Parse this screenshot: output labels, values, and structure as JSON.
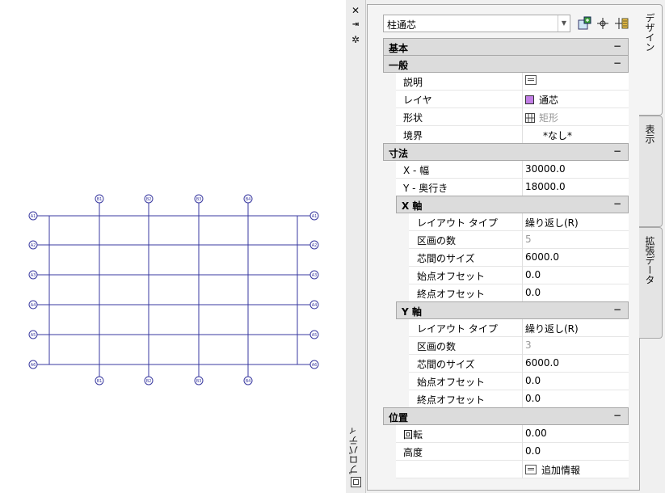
{
  "drawing": {
    "grid_color": "#3a3aa0",
    "col_labels_top": [
      "B1",
      "B2",
      "B3",
      "B4"
    ],
    "col_labels_bottom": [
      "B1",
      "B2",
      "B3",
      "B4"
    ],
    "row_labels_left": [
      "A1",
      "A2",
      "A3",
      "A4",
      "A5",
      "A6"
    ],
    "row_labels_right": [
      "A1",
      "A2",
      "A3",
      "A4",
      "A5",
      "A6"
    ]
  },
  "palette": {
    "title": "プロパティ",
    "style_value": "柱通芯",
    "tabs": [
      "デザイン",
      "表示",
      "拡張データ"
    ],
    "categories": [
      {
        "label": "基本",
        "collapse": "−"
      },
      {
        "label": "一般",
        "collapse": "−",
        "props": [
          {
            "name": "説明",
            "value": ""
          },
          {
            "name": "レイヤ",
            "value": "通芯"
          },
          {
            "name": "形状",
            "value": "矩形"
          },
          {
            "name": "境界",
            "value": "*なし*"
          }
        ]
      },
      {
        "label": "寸法",
        "collapse": "−",
        "props": [
          {
            "name": "X - 幅",
            "value": "30000.0"
          },
          {
            "name": "Y - 奥行き",
            "value": "18000.0"
          }
        ]
      },
      {
        "label": "X 軸",
        "collapse": "−",
        "props": [
          {
            "name": "レイアウト タイプ",
            "value": "繰り返し(R)"
          },
          {
            "name": "区画の数",
            "value": "5"
          },
          {
            "name": "芯間のサイズ",
            "value": "6000.0"
          },
          {
            "name": "始点オフセット",
            "value": "0.0"
          },
          {
            "name": "終点オフセット",
            "value": "0.0"
          }
        ]
      },
      {
        "label": "Y 軸",
        "collapse": "−",
        "props": [
          {
            "name": "レイアウト タイプ",
            "value": "繰り返し(R)"
          },
          {
            "name": "区画の数",
            "value": "3"
          },
          {
            "name": "芯間のサイズ",
            "value": "6000.0"
          },
          {
            "name": "始点オフセット",
            "value": "0.0"
          },
          {
            "name": "終点オフセット",
            "value": "0.0"
          }
        ]
      },
      {
        "label": "位置",
        "collapse": "−",
        "props": [
          {
            "name": "回転",
            "value": "0.00"
          },
          {
            "name": "高度",
            "value": "0.0"
          },
          {
            "name": "",
            "value": "追加情報"
          }
        ]
      }
    ],
    "layer_color": "#c27fe6"
  }
}
